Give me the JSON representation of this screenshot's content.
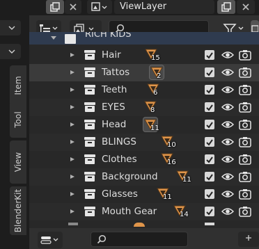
{
  "topbar": {
    "view_layer": "ViewLayer"
  },
  "sidebar": {
    "tabs": [
      "Item",
      "Tool",
      "View",
      "BlenderKit"
    ]
  },
  "outliner": {
    "search_placeholder": "",
    "parent_collection": "RICH KIDS",
    "rows": [
      {
        "label": "Hair",
        "count": "15"
      },
      {
        "label": "Tattos",
        "count": "2"
      },
      {
        "label": "Teeth",
        "count": "6"
      },
      {
        "label": "EYES",
        "count": "8"
      },
      {
        "label": "Head",
        "count": "11"
      },
      {
        "label": "BLINGS",
        "count": "10"
      },
      {
        "label": "Clothes",
        "count": "16"
      },
      {
        "label": "Background",
        "count": "11"
      },
      {
        "label": "Glasses",
        "count": "11"
      },
      {
        "label": "Mouth Gear",
        "count": "14"
      }
    ]
  },
  "colors": {
    "accent": "#e0954a",
    "checkbox": "#d9d9d9",
    "highlight_row": "#3b3b3b"
  }
}
